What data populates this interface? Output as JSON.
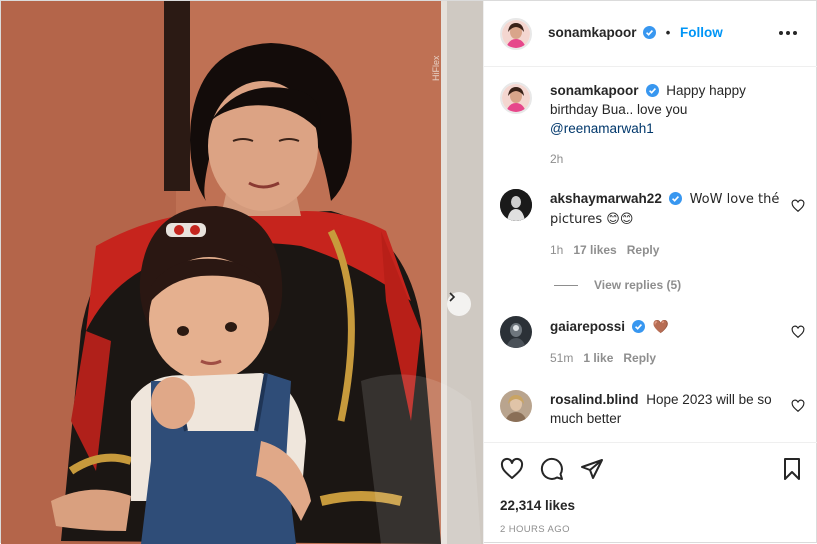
{
  "post": {
    "author": "sonamkapoor",
    "follow_label": "Follow",
    "separator": "•",
    "caption_text": "Happy happy birthday Bua.. love you",
    "caption_mention": "@reenamarwah1",
    "caption_time": "2h",
    "likes": "22,314 likes",
    "time_ago": "2 HOURS AGO"
  },
  "comments": [
    {
      "user": "akshaymarwah22",
      "verified": true,
      "text": "WoW love thé pictures 😊😊",
      "time": "1h",
      "likes": "17 likes",
      "reply": "Reply"
    },
    {
      "user": "gaiarepossi",
      "verified": true,
      "text": "🤎",
      "time": "51m",
      "likes": "1 like",
      "reply": "Reply"
    },
    {
      "user": "rosalind.blind",
      "verified": false,
      "text": "Hope 2023 will be so much better"
    }
  ],
  "view_replies": "View replies (5)",
  "icons": {
    "verified": "verified-badge-icon",
    "more": "more-options-icon",
    "heart": "heart-icon",
    "comment": "comment-icon",
    "share": "share-icon",
    "save": "bookmark-icon",
    "next": "chevron-right-icon"
  },
  "colors": {
    "accent": "#0095f6",
    "verified": "#3897f0",
    "mention": "#00376b",
    "muted": "#8e8e8e"
  }
}
